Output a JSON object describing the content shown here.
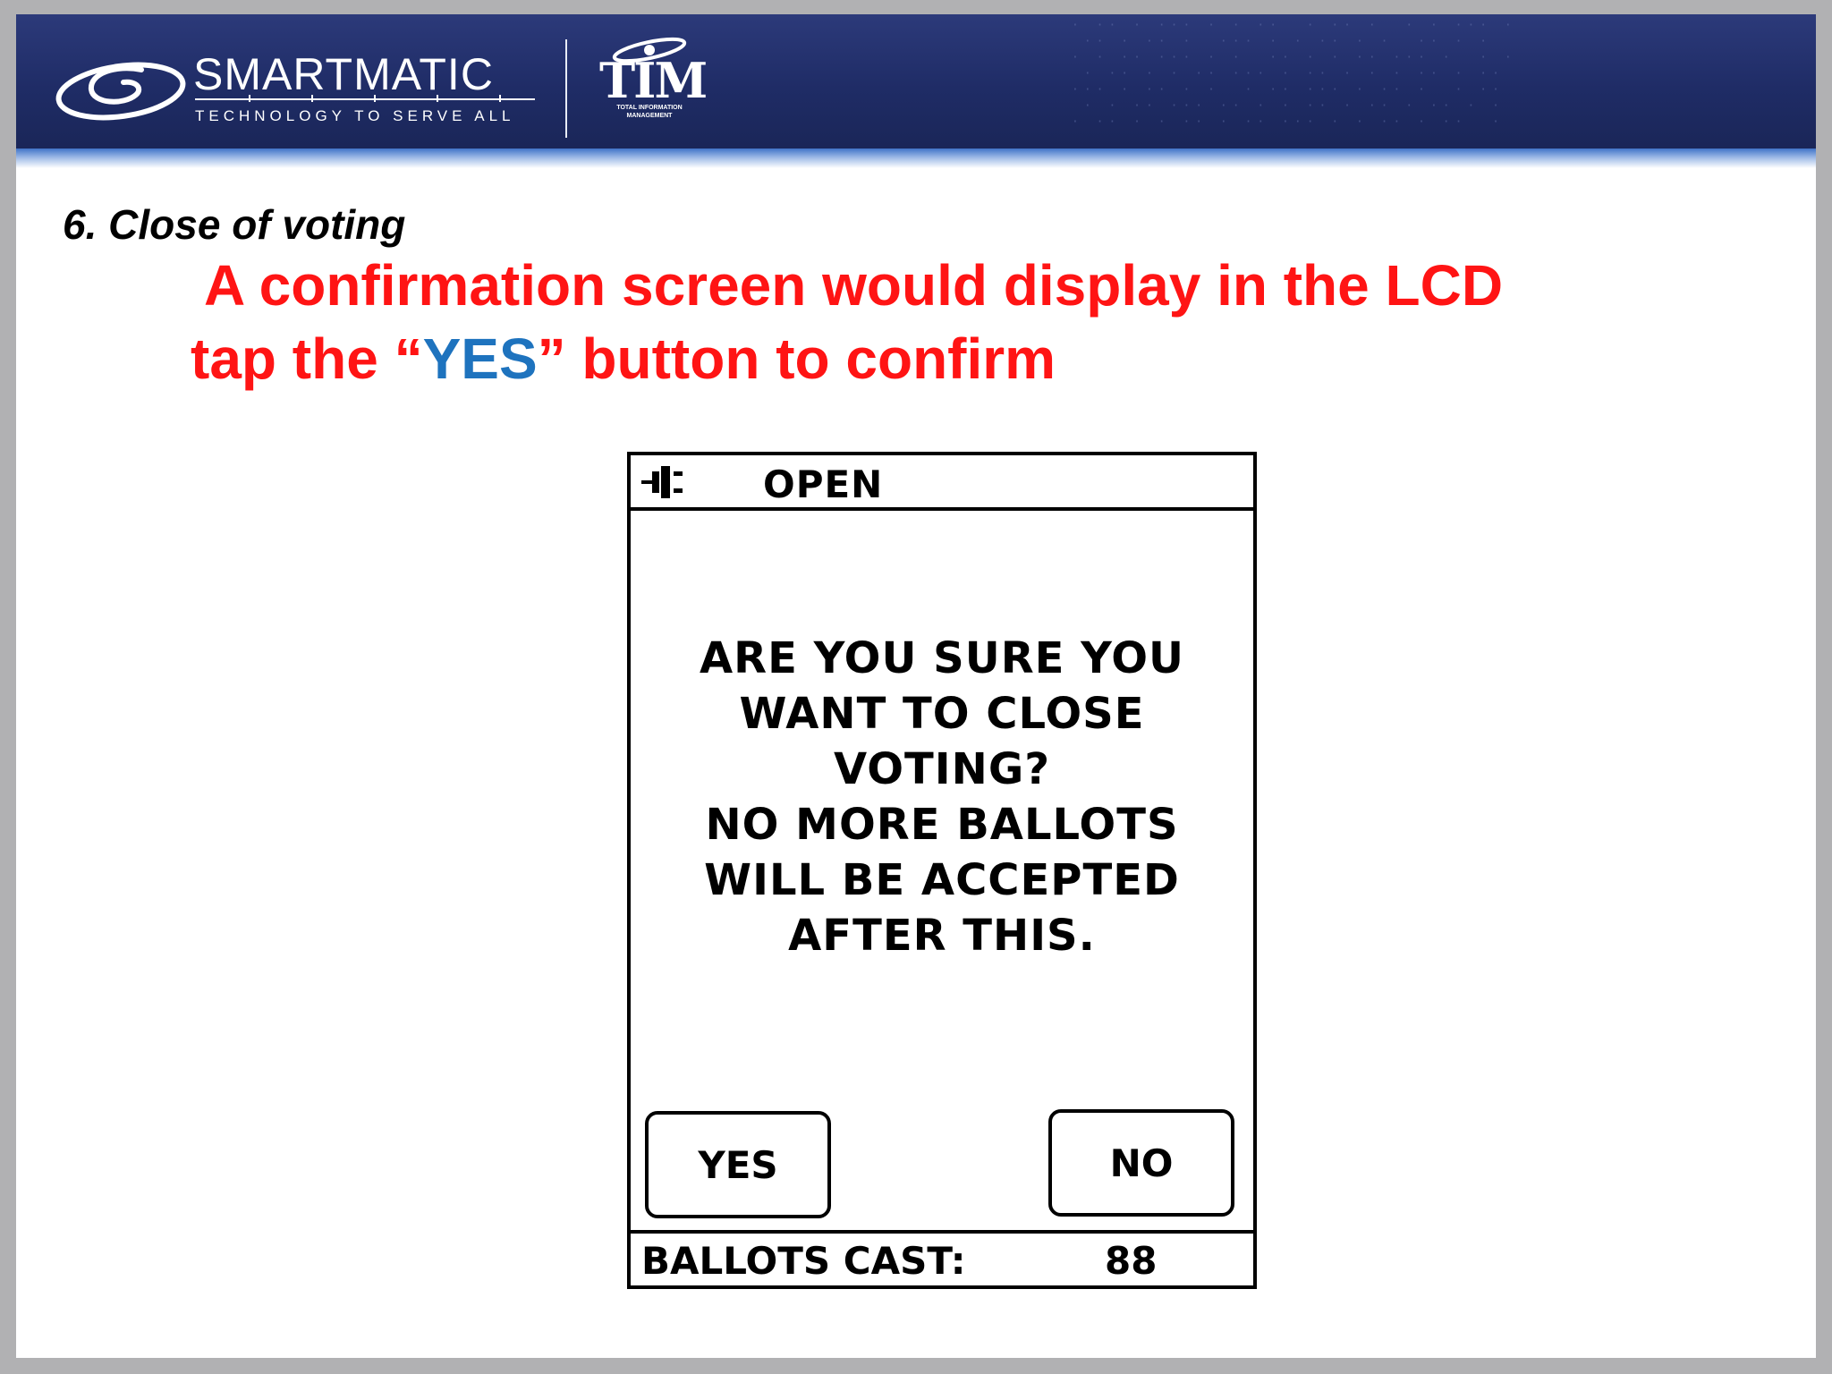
{
  "header": {
    "brand_name": "SMARTMATIC",
    "brand_tagline": "TECHNOLOGY TO SERVE ALL",
    "partner_logo": "TIM",
    "partner_subtitle_line1": "TOTAL INFORMATION",
    "partner_subtitle_line2": "MANAGEMENT",
    "colors": {
      "banner": "#1f2c66",
      "accent_line": "#3f73c8"
    }
  },
  "slide": {
    "section_title": "6. Close of voting",
    "instruction_line1": "A confirmation screen would display in the LCD",
    "instruction_line2_prefix": "tap the “",
    "instruction_line2_highlight": "YES",
    "instruction_line2_suffix": "” button to confirm",
    "colors": {
      "instruction": "#ff1414",
      "highlight": "#1e73be"
    }
  },
  "lcd": {
    "status_icon": "power-plug-icon",
    "status": "OPEN",
    "message_lines": [
      "ARE YOU SURE YOU",
      "WANT TO CLOSE",
      "VOTING?",
      "NO MORE BALLOTS",
      "WILL BE ACCEPTED",
      "AFTER THIS."
    ],
    "yes_label": "YES",
    "no_label": "NO",
    "ballots_cast_label": "BALLOTS CAST:",
    "ballots_cast_value": "88"
  }
}
